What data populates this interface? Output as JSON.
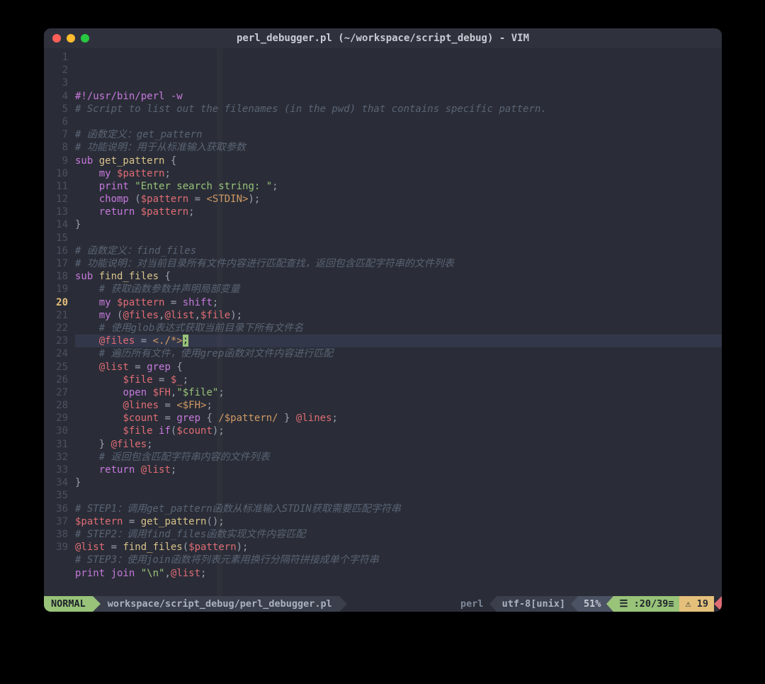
{
  "titlebar": {
    "title": "perl_debugger.pl (~/workspace/script_debug) - VIM"
  },
  "gutter": {
    "active_line": 20,
    "total_lines": 39,
    "tilde_rows": 2
  },
  "code": {
    "lines": [
      {
        "n": 1,
        "t": [
          [
            "kw",
            "#!/usr/bin/perl -w"
          ]
        ]
      },
      {
        "n": 2,
        "t": [
          [
            "c",
            "# Script to list out the filenames (in the pwd) that contains specific pattern."
          ]
        ]
      },
      {
        "n": 3,
        "t": []
      },
      {
        "n": 4,
        "t": [
          [
            "c",
            "# 函数定义：get_pattern"
          ]
        ]
      },
      {
        "n": 5,
        "t": [
          [
            "c",
            "# 功能说明：用于从标准输入获取参数"
          ]
        ]
      },
      {
        "n": 6,
        "t": [
          [
            "kw",
            "sub "
          ],
          [
            "fn",
            "get_pattern"
          ],
          [
            "p",
            " {"
          ]
        ]
      },
      {
        "n": 7,
        "t": [
          [
            "p",
            "    "
          ],
          [
            "kw",
            "my "
          ],
          [
            "var",
            "$pattern"
          ],
          [
            "p",
            ";"
          ]
        ]
      },
      {
        "n": 8,
        "t": [
          [
            "p",
            "    "
          ],
          [
            "kw",
            "print "
          ],
          [
            "str",
            "\"Enter search string: \""
          ],
          [
            "p",
            ";"
          ]
        ]
      },
      {
        "n": 9,
        "t": [
          [
            "p",
            "    "
          ],
          [
            "kw",
            "chomp"
          ],
          [
            "p",
            " ("
          ],
          [
            "var",
            "$pattern"
          ],
          [
            "p",
            " = "
          ],
          [
            "cst",
            "<STDIN>"
          ],
          [
            "p",
            ");"
          ]
        ]
      },
      {
        "n": 10,
        "t": [
          [
            "p",
            "    "
          ],
          [
            "kw",
            "return "
          ],
          [
            "var",
            "$pattern"
          ],
          [
            "p",
            ";"
          ]
        ]
      },
      {
        "n": 11,
        "t": [
          [
            "p",
            "}"
          ]
        ]
      },
      {
        "n": 12,
        "t": []
      },
      {
        "n": 13,
        "t": [
          [
            "c",
            "# 函数定义：find_files"
          ]
        ]
      },
      {
        "n": 14,
        "t": [
          [
            "c",
            "# 功能说明：对当前目录所有文件内容进行匹配查找，返回包含匹配字符串的文件列表"
          ]
        ]
      },
      {
        "n": 15,
        "t": [
          [
            "kw",
            "sub "
          ],
          [
            "fn",
            "find_files"
          ],
          [
            "p",
            " {"
          ]
        ]
      },
      {
        "n": 16,
        "t": [
          [
            "p",
            "    "
          ],
          [
            "c",
            "# 获取函数参数并声明局部变量"
          ]
        ]
      },
      {
        "n": 17,
        "t": [
          [
            "p",
            "    "
          ],
          [
            "kw",
            "my "
          ],
          [
            "var",
            "$pattern"
          ],
          [
            "p",
            " = "
          ],
          [
            "kw",
            "shift"
          ],
          [
            "p",
            ";"
          ]
        ]
      },
      {
        "n": 18,
        "t": [
          [
            "p",
            "    "
          ],
          [
            "kw",
            "my"
          ],
          [
            "p",
            " ("
          ],
          [
            "var",
            "@files"
          ],
          [
            "p",
            ","
          ],
          [
            "var",
            "@list"
          ],
          [
            "p",
            ","
          ],
          [
            "var",
            "$file"
          ],
          [
            "p",
            ");"
          ]
        ]
      },
      {
        "n": 19,
        "t": [
          [
            "p",
            "    "
          ],
          [
            "c",
            "# 使用glob表达式获取当前目录下所有文件名"
          ]
        ]
      },
      {
        "n": 20,
        "hl": true,
        "t": [
          [
            "p",
            "    "
          ],
          [
            "var",
            "@files"
          ],
          [
            "p",
            " = "
          ],
          [
            "cst",
            "<./*>"
          ],
          [
            "cursor",
            ";"
          ]
        ]
      },
      {
        "n": 21,
        "t": [
          [
            "p",
            "    "
          ],
          [
            "c",
            "# 遍历所有文件，使用grep函数对文件内容进行匹配"
          ]
        ]
      },
      {
        "n": 22,
        "t": [
          [
            "p",
            "    "
          ],
          [
            "var",
            "@list"
          ],
          [
            "p",
            " = "
          ],
          [
            "kw",
            "grep"
          ],
          [
            "p",
            " {"
          ]
        ]
      },
      {
        "n": 23,
        "t": [
          [
            "p",
            "        "
          ],
          [
            "var",
            "$file"
          ],
          [
            "p",
            " = "
          ],
          [
            "var",
            "$_"
          ],
          [
            "p",
            ";"
          ]
        ]
      },
      {
        "n": 24,
        "t": [
          [
            "p",
            "        "
          ],
          [
            "kw",
            "open "
          ],
          [
            "var",
            "$FH"
          ],
          [
            "p",
            ","
          ],
          [
            "str",
            "\"$file\""
          ],
          [
            "p",
            ";"
          ]
        ]
      },
      {
        "n": 25,
        "t": [
          [
            "p",
            "        "
          ],
          [
            "var",
            "@lines"
          ],
          [
            "p",
            " = "
          ],
          [
            "cst",
            "<$FH>"
          ],
          [
            "p",
            ";"
          ]
        ]
      },
      {
        "n": 26,
        "t": [
          [
            "p",
            "        "
          ],
          [
            "var",
            "$count"
          ],
          [
            "p",
            " = "
          ],
          [
            "kw",
            "grep"
          ],
          [
            "p",
            " { "
          ],
          [
            "re",
            "/$pattern/"
          ],
          [
            "p",
            " } "
          ],
          [
            "var",
            "@lines"
          ],
          [
            "p",
            ";"
          ]
        ]
      },
      {
        "n": 27,
        "t": [
          [
            "p",
            "        "
          ],
          [
            "var",
            "$file"
          ],
          [
            "p",
            " "
          ],
          [
            "kw",
            "if"
          ],
          [
            "p",
            "("
          ],
          [
            "var",
            "$count"
          ],
          [
            "p",
            ");"
          ]
        ]
      },
      {
        "n": 28,
        "t": [
          [
            "p",
            "    } "
          ],
          [
            "var",
            "@files"
          ],
          [
            "p",
            ";"
          ]
        ]
      },
      {
        "n": 29,
        "t": [
          [
            "p",
            "    "
          ],
          [
            "c",
            "# 返回包含匹配字符串内容的文件列表"
          ]
        ]
      },
      {
        "n": 30,
        "t": [
          [
            "p",
            "    "
          ],
          [
            "kw",
            "return "
          ],
          [
            "var",
            "@list"
          ],
          [
            "p",
            ";"
          ]
        ]
      },
      {
        "n": 31,
        "t": [
          [
            "p",
            "}"
          ]
        ]
      },
      {
        "n": 32,
        "t": []
      },
      {
        "n": 33,
        "t": [
          [
            "c",
            "# STEP1：调用get_pattern函数从标准输入STDIN获取需要匹配字符串"
          ]
        ]
      },
      {
        "n": 34,
        "t": [
          [
            "var",
            "$pattern"
          ],
          [
            "p",
            " = "
          ],
          [
            "fn",
            "get_pattern"
          ],
          [
            "p",
            "();"
          ]
        ]
      },
      {
        "n": 35,
        "t": [
          [
            "c",
            "# STEP2：调用find_files函数实现文件内容匹配"
          ]
        ]
      },
      {
        "n": 36,
        "t": [
          [
            "var",
            "@list"
          ],
          [
            "p",
            " = "
          ],
          [
            "fn",
            "find_files"
          ],
          [
            "p",
            "("
          ],
          [
            "var",
            "$pattern"
          ],
          [
            "p",
            ");"
          ]
        ]
      },
      {
        "n": 37,
        "t": [
          [
            "c",
            "# STEP3：使用join函数将列表元素用换行分隔符拼接成单个字符串"
          ]
        ]
      },
      {
        "n": 38,
        "t": [
          [
            "kw",
            "print "
          ],
          [
            "kw",
            "join "
          ],
          [
            "str",
            "\"\\n\""
          ],
          [
            "p",
            ","
          ],
          [
            "var",
            "@list"
          ],
          [
            "p",
            ";"
          ]
        ]
      },
      {
        "n": 39,
        "t": []
      }
    ]
  },
  "status": {
    "mode": "NORMAL",
    "path": "workspace/script_debug/perl_debugger.pl",
    "filetype": "perl",
    "encoding": "utf-8[unix]",
    "percent": "51%",
    "position": "☰ :20/39≡",
    "col_diag": "⚠ 19"
  }
}
